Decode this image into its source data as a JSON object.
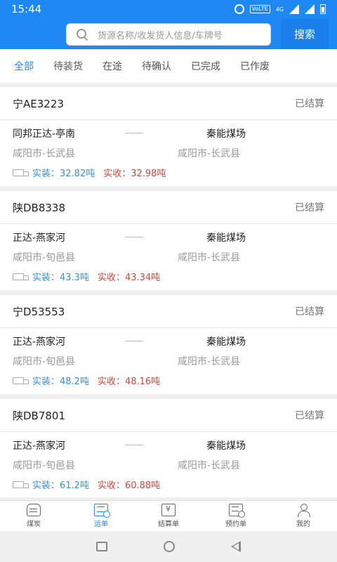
{
  "status_bar": {
    "time": "15:44",
    "network": "VoLTE",
    "signal": "4G"
  },
  "search": {
    "placeholder": "货源名称/收发货人信息/车牌号",
    "button_label": "搜索"
  },
  "tabs": [
    {
      "label": "全部",
      "active": true
    },
    {
      "label": "待装货",
      "active": false
    },
    {
      "label": "在途",
      "active": false
    },
    {
      "label": "待确认",
      "active": false
    },
    {
      "label": "已完成",
      "active": false
    },
    {
      "label": "已作废",
      "active": false
    }
  ],
  "orders": [
    {
      "plate": "宁AE3223",
      "status": "已结算",
      "from": "同邦正达-亭南",
      "to": "秦能煤场",
      "from_region": "咸阳市-长武县",
      "to_region": "咸阳市-长武县",
      "load_label": "实装：32.82吨",
      "receive_label": "实收：32.98吨"
    },
    {
      "plate": "陕DB8338",
      "status": "已结算",
      "from": "正达-燕家河",
      "to": "秦能煤场",
      "from_region": "咸阳市-旬邑县",
      "to_region": "咸阳市-长武县",
      "load_label": "实装：43.3吨",
      "receive_label": "实收：43.34吨"
    },
    {
      "plate": "宁D53553",
      "status": "已结算",
      "from": "正达-燕家河",
      "to": "秦能煤场",
      "from_region": "咸阳市-旬邑县",
      "to_region": "咸阳市-长武县",
      "load_label": "实装：48.2吨",
      "receive_label": "实收：48.16吨"
    },
    {
      "plate": "陕DB7801",
      "status": "已结算",
      "from": "正达-燕家河",
      "to": "秦能煤场",
      "from_region": "咸阳市-旬邑县",
      "to_region": "咸阳市-长武县",
      "load_label": "实装：61.2吨",
      "receive_label": "实收：60.88吨"
    }
  ],
  "bottom_nav": [
    {
      "label": "煤炭",
      "icon": "coal-icon",
      "active": false
    },
    {
      "label": "运单",
      "icon": "waybill-icon",
      "active": true
    },
    {
      "label": "结算单",
      "icon": "settlement-icon",
      "active": false
    },
    {
      "label": "预约单",
      "icon": "booking-icon",
      "active": false
    },
    {
      "label": "我的",
      "icon": "profile-icon",
      "active": false
    }
  ],
  "colors": {
    "primary": "#1e88f5",
    "load_text": "#3a8fd6",
    "receive_text": "#d0463b"
  }
}
